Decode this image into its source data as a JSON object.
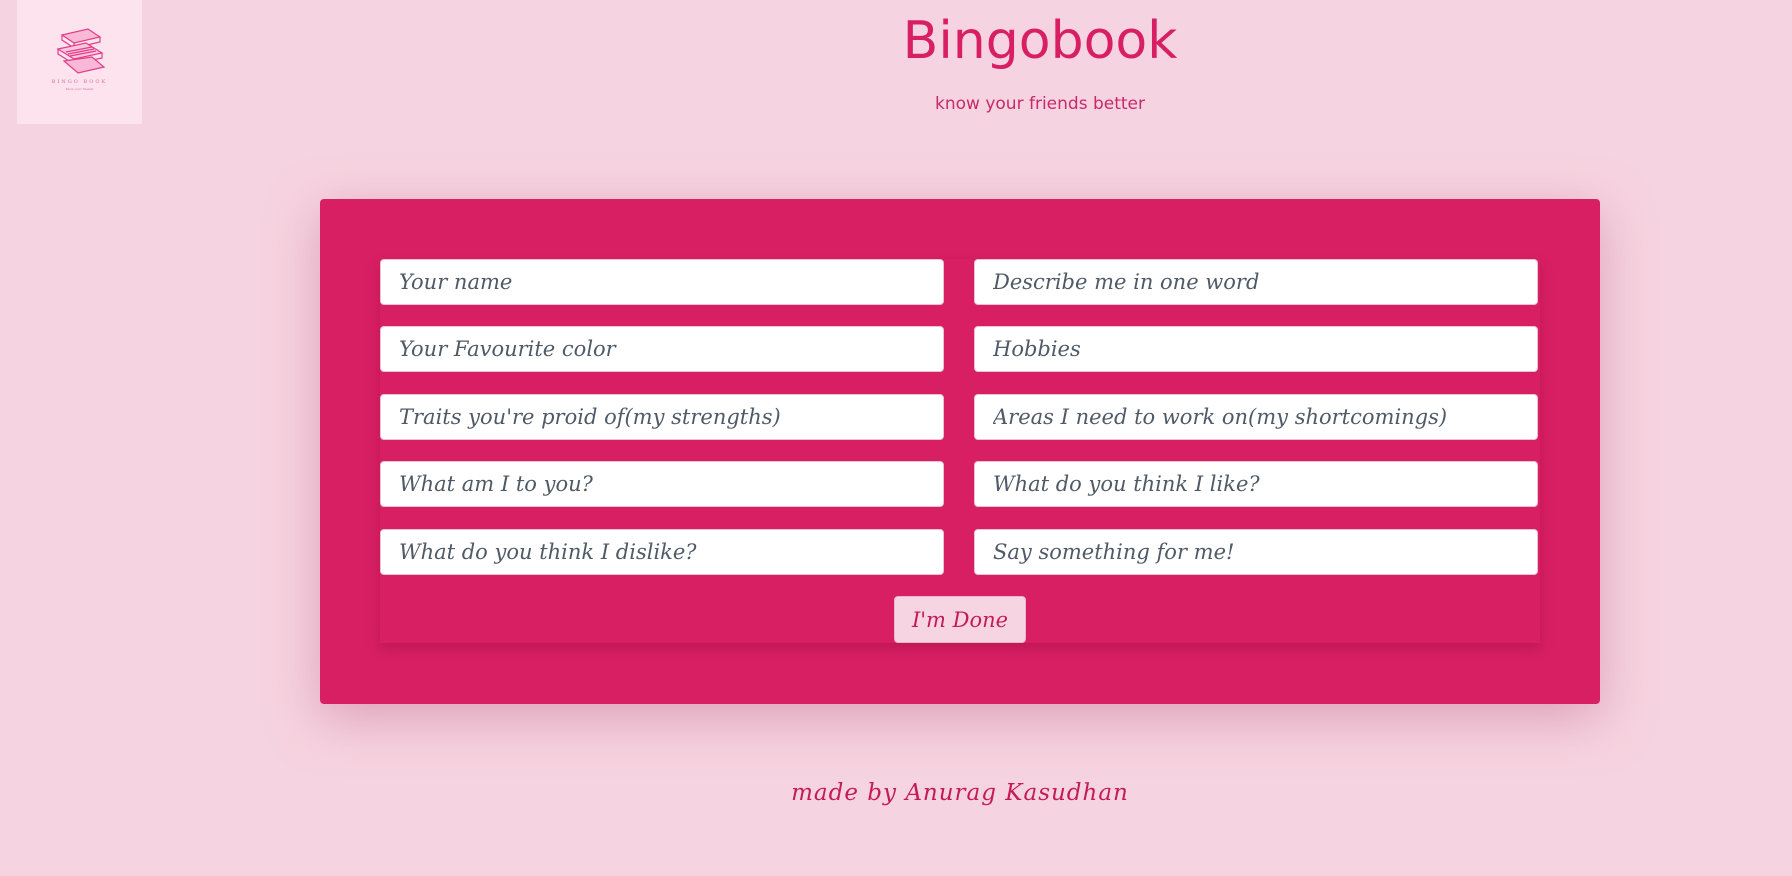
{
  "header": {
    "logo_text": "BINGO BOOK",
    "logo_subtext": "know your friends",
    "title": "Bingobook",
    "subtitle": "know your friends better"
  },
  "form": {
    "fields": {
      "name": {
        "placeholder": "Your name",
        "value": ""
      },
      "describe": {
        "placeholder": "Describe me in one word",
        "value": ""
      },
      "color": {
        "placeholder": "Your Favourite color",
        "value": ""
      },
      "hobbies": {
        "placeholder": "Hobbies",
        "value": ""
      },
      "strengths": {
        "placeholder": "Traits you're proid of(my strengths)",
        "value": ""
      },
      "shortcomings": {
        "placeholder": "Areas I need to work on(my shortcomings)",
        "value": ""
      },
      "relation": {
        "placeholder": "What am I to you?",
        "value": ""
      },
      "likes": {
        "placeholder": "What do you think I like?",
        "value": ""
      },
      "dislikes": {
        "placeholder": "What do you think I dislike?",
        "value": ""
      },
      "message": {
        "placeholder": "Say something for me!",
        "value": ""
      }
    },
    "submit_label": "I'm Done"
  },
  "footer": {
    "credit": "made by Anurag Kasudhan"
  },
  "colors": {
    "background": "#f6d3e0",
    "accent": "#d81f63",
    "button_bg": "#f7d4e2"
  },
  "icons": {
    "logo": "books-icon"
  }
}
